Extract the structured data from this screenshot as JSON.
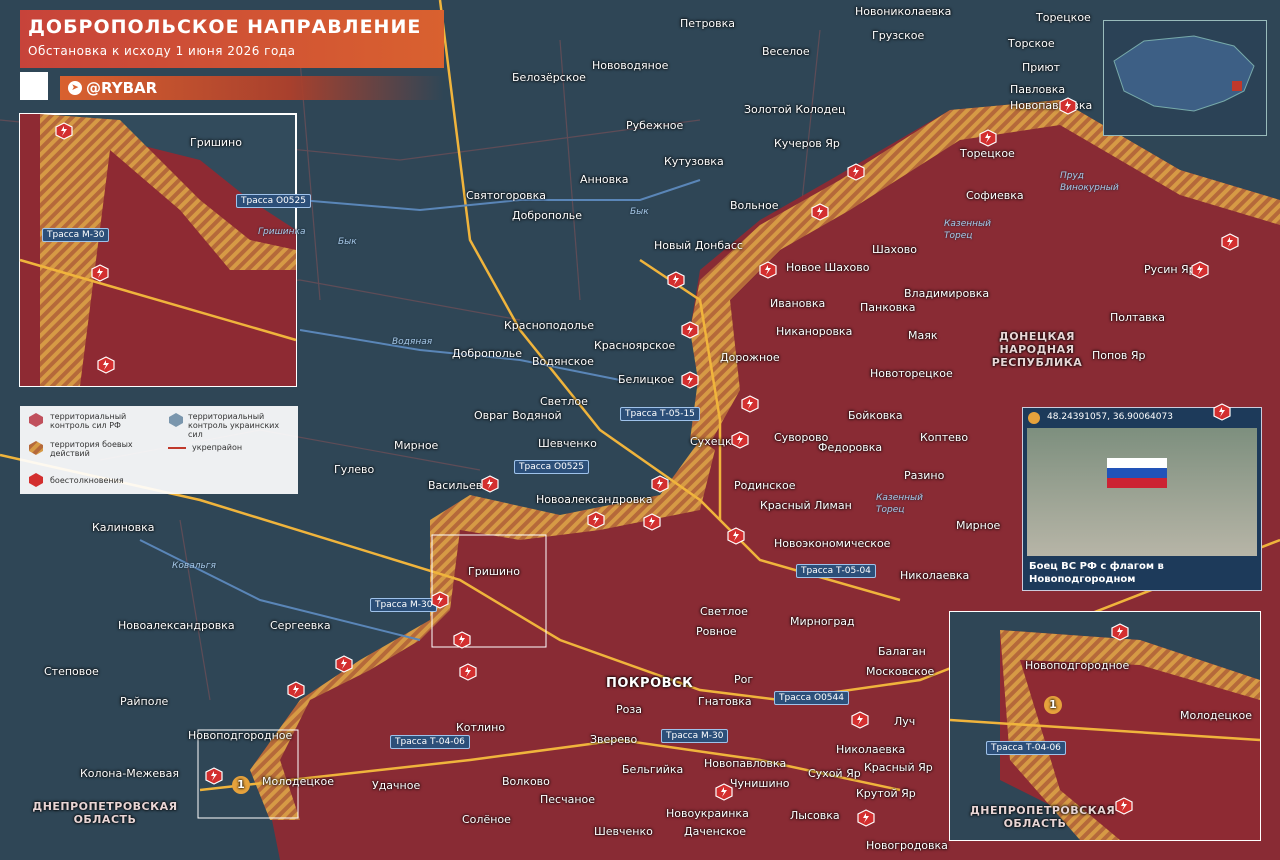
{
  "header": {
    "title": "ДОБРОПОЛЬСКОЕ НАПРАВЛЕНИЕ",
    "subtitle": "Обстановка к исходу 1 июня 2026 года",
    "brand": "@RYBAR"
  },
  "legend": {
    "ru_control": "территориальный контроль сил РФ",
    "ua_control": "территориальный контроль украинских сил",
    "combat_zone": "территория боевых действий",
    "fortification": "укрепрайон",
    "clashes": "боестолкновения"
  },
  "regions": {
    "dnr": "ДОНЕЦКАЯ НАРОДНАЯ РЕСПУБЛИКА",
    "dnipro": "ДНЕПРОПЕТРОВСКАЯ ОБЛАСТЬ",
    "dnipro_inset": "ДНЕПРОПЕТРОВСКАЯ ОБЛАСТЬ"
  },
  "photo": {
    "coords": "48.24391057, 36.90064073",
    "caption": "Боец ВС РФ с флагом в Новоподгородном"
  },
  "roads": {
    "m30_a": "Трасса М-30",
    "o0525_a": "Трасса О0525",
    "t0515": "Трасса Т-05-15",
    "o0525_b": "Трасса О0525",
    "m30_b": "Трасса М-30",
    "t0504": "Трасса Т-05-04",
    "o0544": "Трасса О0544",
    "m30_c": "Трасса М-30",
    "t0406": "Трасса Т-04-06",
    "t0406_inset": "Трасса Т-04-06"
  },
  "rivers": {
    "byk1": "Бык",
    "byk2": "Бык",
    "grishinka": "Гришинка",
    "vodyanaya": "Водяная",
    "kazenny1": "Казенный Торец",
    "kazenny2": "Казенный Торец",
    "kovalgya": "Ковальгя",
    "prud": "Пруд Винокурный"
  },
  "places": {
    "novonikolaevka": "Новониколаевка",
    "toretskoe": "Торецкое",
    "petrovka": "Петровка",
    "gruzskoe": "Грузское",
    "torskoe": "Торское",
    "belozerskoe": "Белозёрское",
    "veseloe": "Веселое",
    "novovodyanoe": "Нововодяное",
    "priyut": "Приют",
    "pavlovka": "Павловка",
    "novopavlovka": "Новопавловка",
    "zolotoy": "Золотой Колодец",
    "rubezhnoe": "Рубежное",
    "kucherov": "Кучеров Яр",
    "kutuzovka": "Кутузовка",
    "toretskoe2": "Торецкое",
    "annovka": "Анновка",
    "svyatogorovka": "Святогоровка",
    "volnoe": "Вольное",
    "sofievka": "Софиевка",
    "dobropolye": "Доброполье",
    "novy_donbass": "Новый Донбасс",
    "shakhovo": "Шахово",
    "novoe_shakhovo": "Новое Шахово",
    "rusin_yar": "Русин Яр",
    "ivanovka": "Ивановка",
    "vladimirovka": "Владимировка",
    "pankovka": "Панковка",
    "poltavka": "Полтавка",
    "krasnopodolye": "Красноподолье",
    "nikanorovka": "Никаноровка",
    "dobropolye2": "Доброполье",
    "krasnoyarskoe": "Красноярское",
    "vodyanskoe": "Водянское",
    "mayak": "Маяк",
    "dorozhnoe": "Дорожное",
    "popov_yar": "Попов Яр",
    "belitskoe": "Белицкое",
    "novotoretskoe": "Новоторецкое",
    "svetloe": "Светлое",
    "bojkovka": "Бойковка",
    "ovrag": "Овраг Водяной",
    "suhetskoe": "Сухецкое",
    "suvorovo": "Суворово",
    "koptevo": "Коптево",
    "shevchenko": "Шевченко",
    "fedorovka": "Федоровка",
    "mirnoe": "Мирное",
    "gulevo": "Гулево",
    "razino": "Разино",
    "vasilevka": "Васильевка",
    "novoaleksandrovka": "Новоалександровка",
    "rodinskoe": "Родинское",
    "krasny_liman": "Красный Лиман",
    "mirnoe2": "Мирное",
    "kalinovka": "Калиновка",
    "novoekonomicheskoe": "Новоэкономическое",
    "grishino": "Гришино",
    "nikolaevka": "Николаевка",
    "novoaleksandrovka2": "Новоалександровка",
    "sergeevka": "Сергеевка",
    "svetloe2": "Светлое",
    "rovnoe": "Ровное",
    "mirnograd": "Мирноград",
    "balagan": "Балаган",
    "stepovoe": "Степовое",
    "moskovskoe": "Московское",
    "pokrovsk": "ПОКРОВСК",
    "rog": "Рог",
    "rayole": "Райполе",
    "gnatovka": "Гнатовка",
    "roza": "Роза",
    "luch": "Луч",
    "novopodgorodnoe": "Новоподгородное",
    "kotlino": "Котлино",
    "zverevo": "Зверево",
    "nikolaevka2": "Николаевка",
    "novopavlovka2": "Новопавловка",
    "suhoy_yar": "Сухой Яр",
    "krasny_yar": "Красный Яр",
    "kolona": "Колона-Межевая",
    "beligiyka": "Бельгийка",
    "molodetskoe": "Молодецкое",
    "udachnoe": "Удачное",
    "chunishino": "Чунишино",
    "krutoy_yar": "Крутой Яр",
    "volkovo": "Волково",
    "pesчanoe": "Песчаное",
    "novoukrainka": "Новоукраинка",
    "lysovka": "Лысовка",
    "solenoe": "Солёное",
    "shevchenko2": "Шевченко",
    "dachenskoe": "Даченское",
    "novogrodovka": "Новогродовка"
  },
  "inset_grishino": {
    "grishino": "Гришино",
    "road_o0525": "Трасса О0525",
    "road_m30": "Трасса М-30",
    "river": "Гришинка"
  },
  "inset_novopodgorodnoe": {
    "town": "Новоподгородное",
    "molodetskoe": "Молодецкое"
  },
  "markers": {
    "inset_marker": "1",
    "map_marker": "1"
  },
  "colors": {
    "ru": "#8e2a33",
    "ua": "#2f4656",
    "combat": "#c88a3f",
    "roads": "#f0b43c",
    "accent": "#d9612f"
  }
}
